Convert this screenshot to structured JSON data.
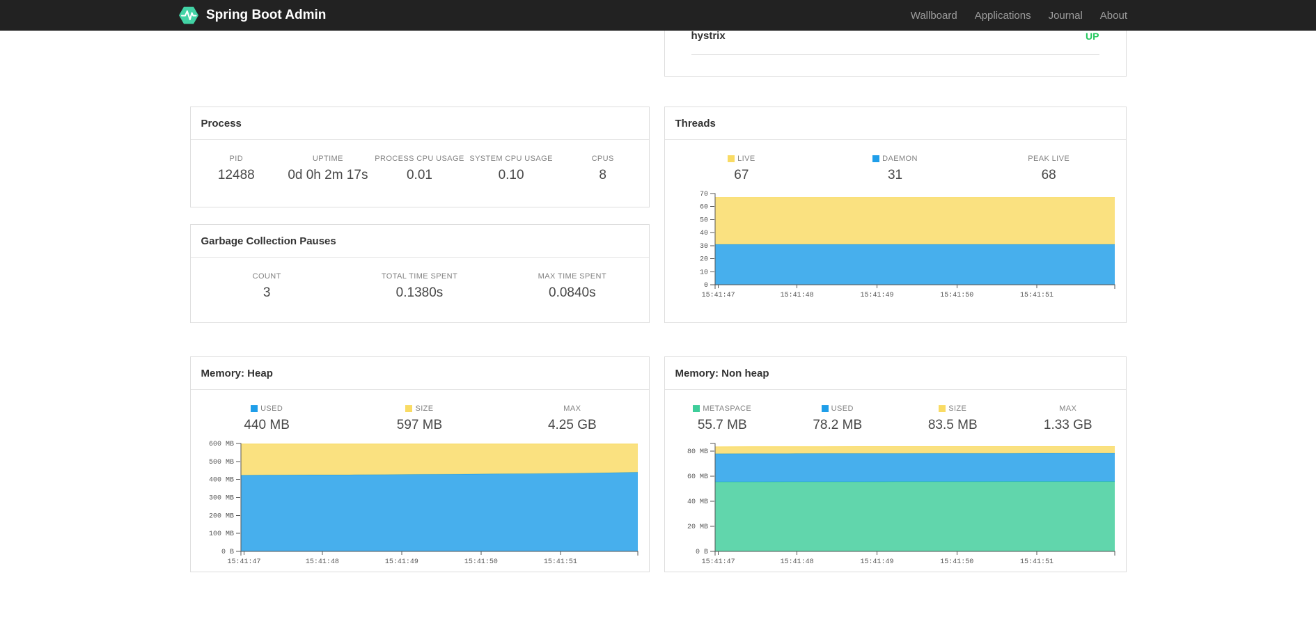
{
  "navbar": {
    "brand": "Spring Boot Admin",
    "items": [
      "Wallboard",
      "Applications",
      "Journal",
      "About"
    ]
  },
  "application": {
    "name": "hystrix",
    "status": "UP"
  },
  "colors": {
    "navbar_bg": "#222222",
    "brand_logo_green": "#42d3a5",
    "status_up": "#24c75e",
    "series_yellow": "#f9db64",
    "series_blue": "#1f9ee9",
    "series_green": "#3ecd9a"
  },
  "cards": {
    "process": {
      "title": "Process",
      "stats": [
        {
          "label": "PID",
          "value": "12488"
        },
        {
          "label": "UPTIME",
          "value": "0d 0h 2m 17s"
        },
        {
          "label": "PROCESS CPU USAGE",
          "value": "0.01"
        },
        {
          "label": "SYSTEM CPU USAGE",
          "value": "0.10"
        },
        {
          "label": "CPUS",
          "value": "8"
        }
      ]
    },
    "gc": {
      "title": "Garbage Collection Pauses",
      "stats": [
        {
          "label": "COUNT",
          "value": "3"
        },
        {
          "label": "TOTAL TIME SPENT",
          "value": "0.1380s"
        },
        {
          "label": "MAX TIME SPENT",
          "value": "0.0840s"
        }
      ]
    },
    "threads": {
      "title": "Threads",
      "stats": [
        {
          "label": "LIVE",
          "value": "67",
          "swatch": "#f9db64"
        },
        {
          "label": "DAEMON",
          "value": "31",
          "swatch": "#1f9ee9"
        },
        {
          "label": "PEAK LIVE",
          "value": "68"
        }
      ]
    },
    "heap": {
      "title": "Memory: Heap",
      "stats": [
        {
          "label": "USED",
          "value": "440 MB",
          "swatch": "#1f9ee9"
        },
        {
          "label": "SIZE",
          "value": "597 MB",
          "swatch": "#f9db64"
        },
        {
          "label": "MAX",
          "value": "4.25 GB"
        }
      ]
    },
    "nonheap": {
      "title": "Memory: Non heap",
      "stats": [
        {
          "label": "METASPACE",
          "value": "55.7 MB",
          "swatch": "#3ecd9a"
        },
        {
          "label": "USED",
          "value": "78.2 MB",
          "swatch": "#1f9ee9"
        },
        {
          "label": "SIZE",
          "value": "83.5 MB",
          "swatch": "#f9db64"
        },
        {
          "label": "MAX",
          "value": "1.33 GB"
        }
      ]
    }
  },
  "chart_data": [
    {
      "name": "threads",
      "title": "Threads",
      "type": "area",
      "stacking": "overlapping-absolute-values",
      "x_labels": [
        "15:41:47",
        "15:41:48",
        "15:41:49",
        "15:41:50",
        "15:41:51"
      ],
      "x_label_fractions": [
        0.008,
        0.205,
        0.405,
        0.605,
        0.805
      ],
      "y_max": 70,
      "y_ticks": [
        {
          "v": 0,
          "label": "0"
        },
        {
          "v": 10,
          "label": "10"
        },
        {
          "v": 20,
          "label": "20"
        },
        {
          "v": 30,
          "label": "30"
        },
        {
          "v": 40,
          "label": "40"
        },
        {
          "v": 50,
          "label": "50"
        },
        {
          "v": 60,
          "label": "60"
        },
        {
          "v": 70,
          "label": "70"
        }
      ],
      "layers": [
        {
          "name": "DAEMON",
          "color": "#1f9ee9",
          "values": [
            31,
            31,
            31,
            31,
            31,
            31,
            31,
            31,
            31,
            31,
            31,
            31
          ]
        },
        {
          "name": "LIVE",
          "color": "#f9db64",
          "values": [
            67,
            67,
            67,
            67,
            67,
            67,
            67,
            67,
            67,
            67,
            67,
            67
          ]
        }
      ]
    },
    {
      "name": "memory-heap",
      "title": "Memory: Heap",
      "type": "area",
      "stacking": "overlapping-absolute-values",
      "x_labels": [
        "15:41:47",
        "15:41:48",
        "15:41:49",
        "15:41:50",
        "15:41:51"
      ],
      "x_label_fractions": [
        0.008,
        0.205,
        0.405,
        0.605,
        0.805
      ],
      "y_max": 600,
      "y_ticks": [
        {
          "v": 0,
          "label": "0 B"
        },
        {
          "v": 100,
          "label": "100 MB"
        },
        {
          "v": 200,
          "label": "200 MB"
        },
        {
          "v": 300,
          "label": "300 MB"
        },
        {
          "v": 400,
          "label": "400 MB"
        },
        {
          "v": 500,
          "label": "500 MB"
        },
        {
          "v": 600,
          "label": "600 MB"
        }
      ],
      "layers": [
        {
          "name": "USED",
          "color": "#1f9ee9",
          "values": [
            424,
            425,
            426,
            426,
            427,
            428,
            429,
            431,
            432,
            434,
            437,
            440
          ]
        },
        {
          "name": "SIZE",
          "color": "#f9db64",
          "values": [
            597,
            597,
            597,
            597,
            597,
            597,
            597,
            597,
            597,
            597,
            597,
            597
          ]
        }
      ]
    },
    {
      "name": "memory-nonheap",
      "title": "Memory: Non heap",
      "type": "area",
      "stacking": "overlapping-absolute-values",
      "x_labels": [
        "15:41:47",
        "15:41:48",
        "15:41:49",
        "15:41:50",
        "15:41:51"
      ],
      "x_label_fractions": [
        0.008,
        0.205,
        0.405,
        0.605,
        0.805
      ],
      "y_max": 86,
      "y_ticks": [
        {
          "v": 0,
          "label": "0 B"
        },
        {
          "v": 20,
          "label": "20 MB"
        },
        {
          "v": 40,
          "label": "40 MB"
        },
        {
          "v": 60,
          "label": "60 MB"
        },
        {
          "v": 80,
          "label": "80 MB"
        }
      ],
      "layers": [
        {
          "name": "METASPACE",
          "color": "#3ecd9a",
          "values": [
            55.4,
            55.4,
            55.5,
            55.5,
            55.5,
            55.6,
            55.6,
            55.6,
            55.7,
            55.7,
            55.7,
            55.7
          ]
        },
        {
          "name": "USED",
          "color": "#1f9ee9",
          "values": [
            77.8,
            77.9,
            77.9,
            78.0,
            78.0,
            78.0,
            78.1,
            78.1,
            78.1,
            78.2,
            78.2,
            78.2
          ]
        },
        {
          "name": "SIZE",
          "color": "#f9db64",
          "values": [
            83.3,
            83.4,
            83.4,
            83.4,
            83.5,
            83.5,
            83.5,
            83.5,
            83.5,
            83.5,
            83.5,
            83.5
          ]
        }
      ]
    }
  ]
}
